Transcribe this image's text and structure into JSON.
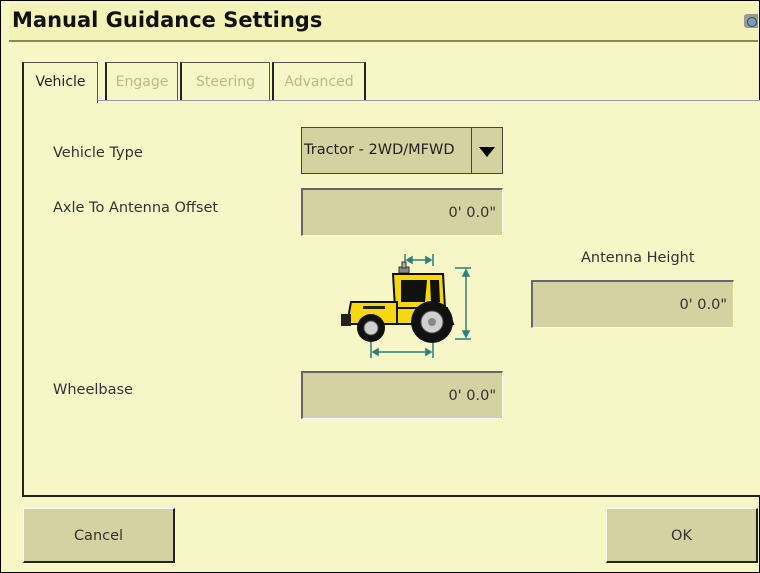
{
  "window": {
    "title": "Manual Guidance Settings",
    "camera_icon": "camera-icon"
  },
  "tabs": [
    {
      "label": "Vehicle",
      "active": true
    },
    {
      "label": "Engage",
      "active": false
    },
    {
      "label": "Steering",
      "active": false
    },
    {
      "label": "Advanced",
      "active": false
    }
  ],
  "vehicle_type": {
    "label": "Vehicle Type",
    "value": "Tractor - 2WD/MFWD"
  },
  "axle_offset": {
    "label": "Axle To Antenna Offset",
    "value": "0' 0.0\""
  },
  "antenna_height": {
    "label": "Antenna Height",
    "value": "0' 0.0\""
  },
  "wheelbase": {
    "label": "Wheelbase",
    "value": "0' 0.0\""
  },
  "buttons": {
    "cancel": "Cancel",
    "ok": "OK"
  },
  "colors": {
    "background": "#F7F6C6",
    "field": "#D3D2A0",
    "tractor_yellow": "#F5D80F",
    "dimension_teal": "#2E7F7A"
  }
}
